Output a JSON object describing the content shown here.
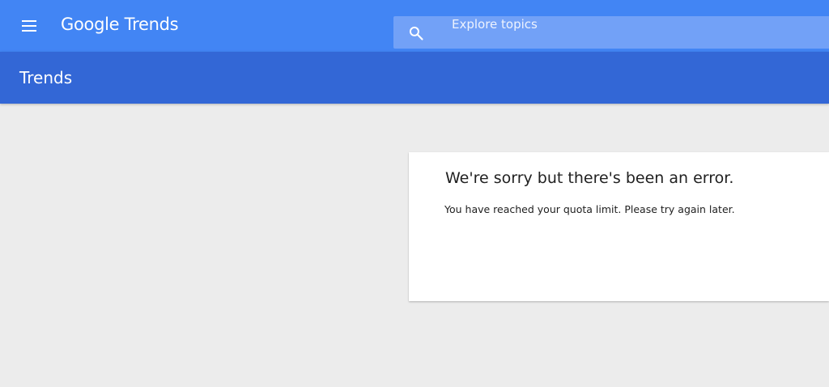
{
  "header": {
    "logo_text": "Google Trends",
    "menu_icon": "hamburger-menu-icon",
    "search": {
      "icon": "search-icon",
      "placeholder": "Explore topics",
      "value": ""
    },
    "accent_color": "#4285f4"
  },
  "subheader": {
    "title": "Trends",
    "color": "#3367d6"
  },
  "error_card": {
    "title": "We're sorry but there's been an error.",
    "message": "You have reached your quota limit. Please try again later."
  }
}
